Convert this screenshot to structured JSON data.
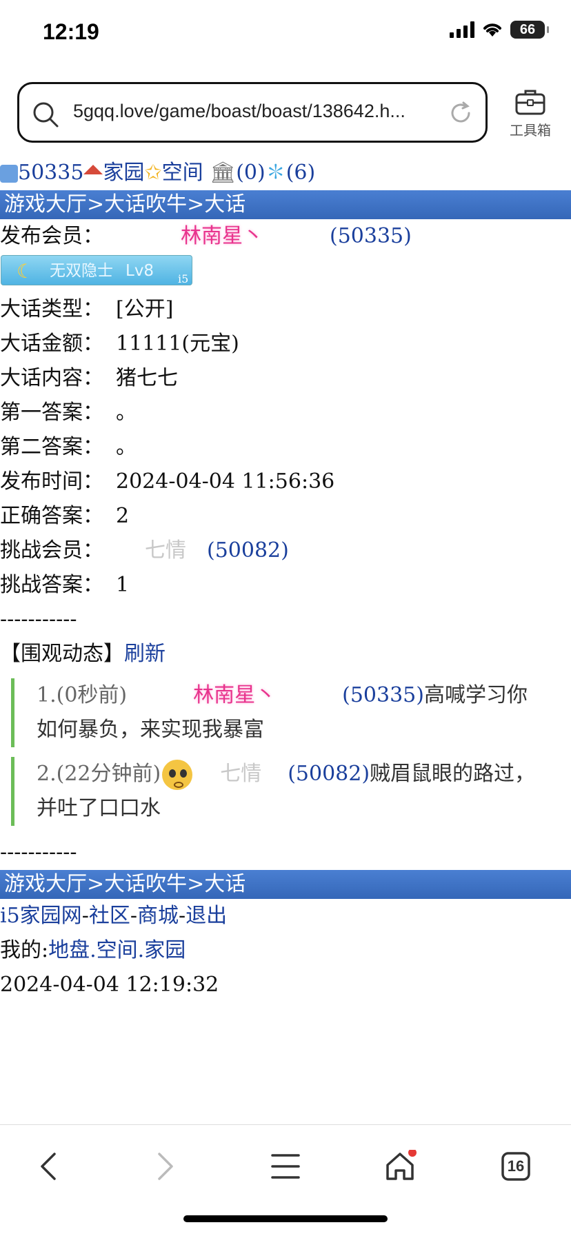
{
  "status_bar": {
    "time": "12:19",
    "battery": "66"
  },
  "browser": {
    "url": "5gqq.love/game/boast/boast/138642.h...",
    "toolbox_label": "工具箱"
  },
  "topnav": {
    "user_id": "50335",
    "home": "家园",
    "space": "空间",
    "bank_count": "(0)",
    "msg_count": "(6)"
  },
  "breadcrumb": {
    "hall": "游戏大厅",
    "sep1": ">",
    "boast": "大话吹牛",
    "sep2": ">",
    "current": "大话"
  },
  "post": {
    "publisher_label": "发布会员：",
    "publisher_name": "林南星丶",
    "publisher_id": "(50335)",
    "badge_text": "无双隐士",
    "badge_level": "Lv8",
    "badge_i5": "i5",
    "type_label": "大话类型：",
    "type_value": "[公开]",
    "amount_label": "大话金额：",
    "amount_value": "11111(元宝)",
    "content_label": "大话内容：",
    "content_value": "猪七七",
    "answer1_label": "第一答案：",
    "answer1_value": "。",
    "answer2_label": "第二答案：",
    "answer2_value": "。",
    "time_label": "发布时间：",
    "time_value": "2024-04-04 11:56:36",
    "correct_label": "正确答案：",
    "correct_value": "2",
    "challenger_label": "挑战会员：",
    "challenger_name": "七情",
    "challenger_id": "(50082)",
    "challenger_answer_label": "挑战答案：",
    "challenger_answer_value": "1"
  },
  "divider": "-----------",
  "feed_header": {
    "title": "【围观动态】",
    "refresh": "刷新"
  },
  "feed": [
    {
      "prefix": "1.(0秒前)",
      "name": "林南星丶",
      "id": "(50335)",
      "text": "高喊学习你如何暴负，来实现我暴富"
    },
    {
      "prefix": "2.(22分钟前)",
      "name": "七情",
      "id": "(50082)",
      "text": "贼眉鼠眼的路过，并吐了口口水"
    }
  ],
  "footer": {
    "site": "i5家园网",
    "dash1": "-",
    "community": "社区",
    "dash2": "-",
    "mall": "商城",
    "dash3": "-",
    "logout": "退出",
    "mine_label": "我的:",
    "land": "地盘",
    "dot1": ".",
    "space": "空间",
    "dot2": ".",
    "home": "家园",
    "timestamp": "2024-04-04 12:19:32"
  },
  "bottom_nav": {
    "tabs_count": "16"
  }
}
